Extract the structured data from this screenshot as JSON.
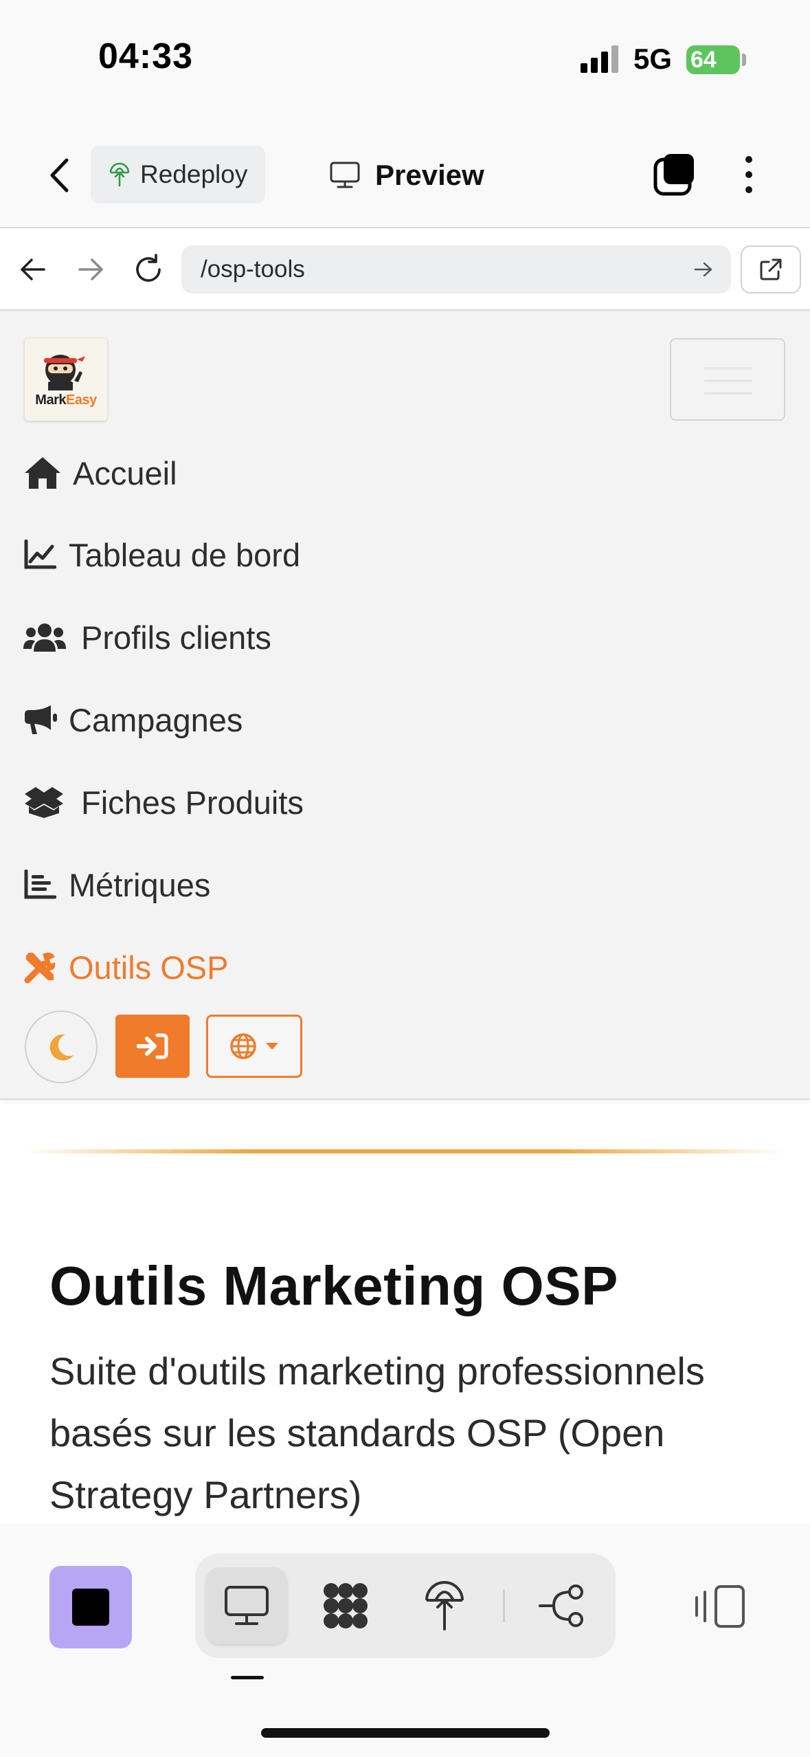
{
  "status_bar": {
    "time": "04:33",
    "network": "5G",
    "battery": "64"
  },
  "toolbar": {
    "redeploy_label": "Redeploy",
    "preview_label": "Preview"
  },
  "browser": {
    "url": "/osp-tools"
  },
  "site": {
    "logo_text_1": "Mark",
    "logo_text_2": "Easy",
    "nav_items": [
      {
        "label": "Accueil",
        "icon": "home-icon"
      },
      {
        "label": "Tableau de bord",
        "icon": "chart-line-icon"
      },
      {
        "label": "Profils clients",
        "icon": "users-icon"
      },
      {
        "label": "Campagnes",
        "icon": "megaphone-icon"
      },
      {
        "label": "Fiches Produits",
        "icon": "box-open-icon"
      },
      {
        "label": "Métriques",
        "icon": "bar-chart-icon"
      },
      {
        "label": "Outils OSP",
        "icon": "tools-icon",
        "active": true
      }
    ],
    "accent_color": "#f07b2b"
  },
  "page": {
    "title": "Outils Marketing OSP",
    "subtitle": "Suite d'outils marketing professionnels basés sur les standards OSP (Open Strategy Partners)"
  },
  "bottom_bar": {
    "stop_color": "#b6a6f4"
  }
}
